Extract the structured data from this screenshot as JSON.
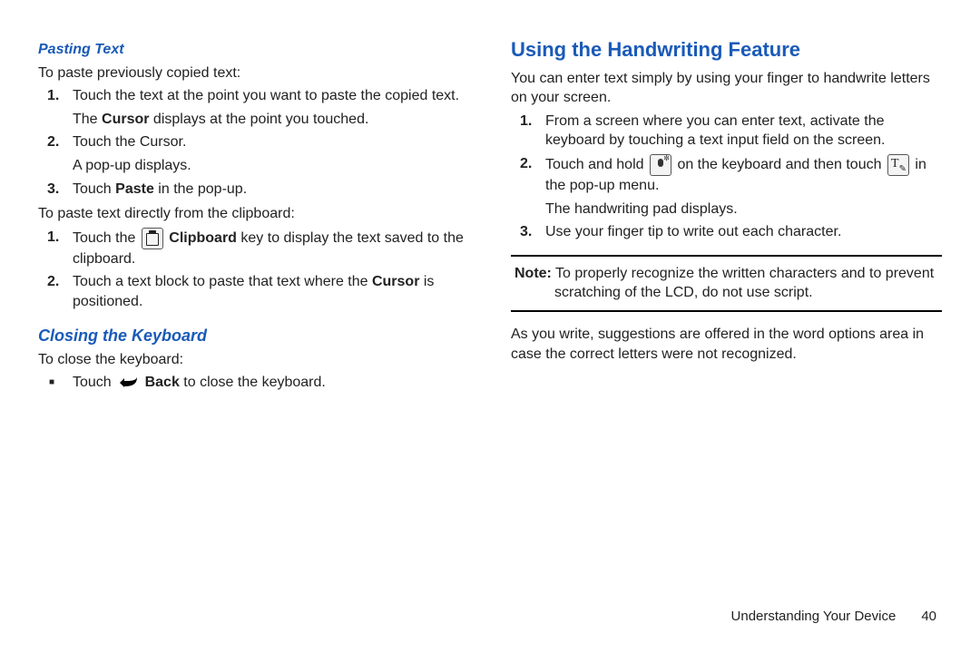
{
  "left": {
    "headingPasting": "Pasting Text",
    "introPaste": "To paste previously copied text:",
    "step1_a": "Touch the text at the point you want to paste the copied text.",
    "step1_b_pre": "The ",
    "step1_b_bold": "Cursor",
    "step1_b_post": " displays at the point you touched.",
    "step2_a": "Touch the Cursor.",
    "step2_b": "A pop-up displays.",
    "step3_pre": "Touch ",
    "step3_bold": "Paste",
    "step3_post": " in the pop-up.",
    "introClipboard": "To paste text directly from the clipboard:",
    "clip_step1_pre": "Touch the ",
    "clip_step1_bold": " Clipboard",
    "clip_step1_post": " key to display the text saved to the clipboard.",
    "clip_step2_pre": "Touch a text block to paste that text where the ",
    "clip_step2_bold": "Cursor",
    "clip_step2_post": " is positioned.",
    "headingClosing": "Closing the Keyboard",
    "introClose": "To close the keyboard:",
    "close_bullet_pre": "Touch ",
    "close_bullet_bold": " Back",
    "close_bullet_post": " to close the keyboard."
  },
  "right": {
    "heading": "Using the Handwriting Feature",
    "intro": "You can enter text simply by using your finger to handwrite letters on your screen.",
    "step1": "From a screen where you can enter text, activate the keyboard by touching a text input field on the screen.",
    "step2_pre": "Touch and hold ",
    "step2_mid": " on the keyboard and then touch ",
    "step2_post": " in the pop-up menu.",
    "step2_sub": "The handwriting pad displays.",
    "step3": "Use your finger tip to write out each character.",
    "note_label": "Note:",
    "note_body": " To properly recognize the written characters and to prevent scratching of the LCD, do not use script.",
    "after_note": "As you write, suggestions are offered in the word options area in case the correct letters were not recognized."
  },
  "footer": {
    "section": "Understanding Your Device",
    "page": "40"
  }
}
